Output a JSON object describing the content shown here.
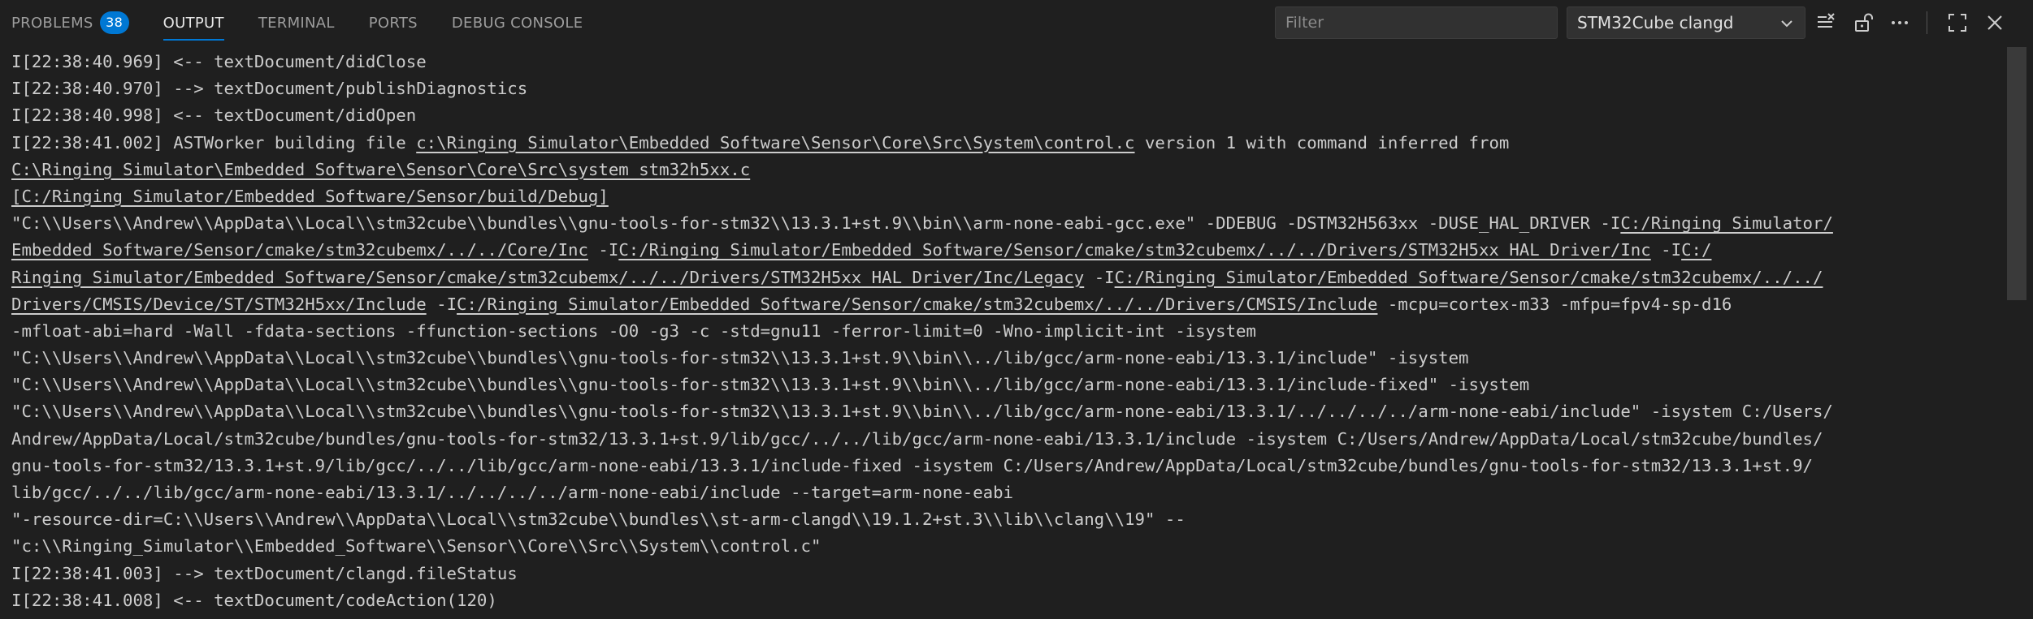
{
  "tabs": [
    {
      "label": "PROBLEMS",
      "badge": "38"
    },
    {
      "label": "OUTPUT"
    },
    {
      "label": "TERMINAL"
    },
    {
      "label": "PORTS"
    },
    {
      "label": "DEBUG CONSOLE"
    }
  ],
  "toolbar": {
    "filter_placeholder": "Filter",
    "channel_selected": "STM32Cube clangd",
    "icons": [
      "clear-output-icon",
      "lock-scroll-icon",
      "more-actions-icon",
      "maximize-panel-icon",
      "close-panel-icon"
    ]
  },
  "output": {
    "lines": [
      [
        {
          "t": "I[22:38:40.969] <-- textDocument/didClose"
        }
      ],
      [
        {
          "t": "I[22:38:40.970] --> textDocument/publishDiagnostics"
        }
      ],
      [
        {
          "t": "I[22:38:40.998] <-- textDocument/didOpen"
        }
      ],
      [
        {
          "t": "I[22:38:41.002] ASTWorker building file "
        },
        {
          "t": "c:\\Ringing_Simulator\\Embedded_Software\\Sensor\\Core\\Src\\System\\control.c",
          "link": true
        },
        {
          "t": " version 1 with command inferred from"
        }
      ],
      [
        {
          "t": "C:\\Ringing_Simulator\\Embedded_Software\\Sensor\\Core\\Src\\system_stm32h5xx.c",
          "link": true
        }
      ],
      [
        {
          "t": "[C:/Ringing_Simulator/Embedded_Software/Sensor/build/Debug]",
          "link": true
        }
      ],
      [
        {
          "t": "\"C:\\\\Users\\\\Andrew\\\\AppData\\\\Local\\\\stm32cube\\\\bundles\\\\gnu-tools-for-stm32\\\\13.3.1+st.9\\\\bin\\\\arm-none-eabi-gcc.exe\" -DDEBUG -DSTM32H563xx -DUSE_HAL_DRIVER -I"
        },
        {
          "t": "C:/Ringing_Simulator/",
          "link": true
        }
      ],
      [
        {
          "t": "Embedded_Software/Sensor/cmake/stm32cubemx/../../Core/Inc",
          "link": true
        },
        {
          "t": " -I"
        },
        {
          "t": "C:/Ringing_Simulator/Embedded_Software/Sensor/cmake/stm32cubemx/../../Drivers/STM32H5xx_HAL_Driver/Inc",
          "link": true
        },
        {
          "t": " -I"
        },
        {
          "t": "C:/",
          "link": true
        }
      ],
      [
        {
          "t": "Ringing_Simulator/Embedded_Software/Sensor/cmake/stm32cubemx/../../Drivers/STM32H5xx_HAL_Driver/Inc/Legacy",
          "link": true
        },
        {
          "t": " -I"
        },
        {
          "t": "C:/Ringing_Simulator/Embedded_Software/Sensor/cmake/stm32cubemx/../../",
          "link": true
        }
      ],
      [
        {
          "t": "Drivers/CMSIS/Device/ST/STM32H5xx/Include",
          "link": true
        },
        {
          "t": " -I"
        },
        {
          "t": "C:/Ringing_Simulator/Embedded_Software/Sensor/cmake/stm32cubemx/../../Drivers/CMSIS/Include",
          "link": true
        },
        {
          "t": " -mcpu=cortex-m33 -mfpu=fpv4-sp-d16"
        }
      ],
      [
        {
          "t": "-mfloat-abi=hard -Wall -fdata-sections -ffunction-sections -O0 -g3 -c -std=gnu11 -ferror-limit=0 -Wno-implicit-int -isystem"
        }
      ],
      [
        {
          "t": "\"C:\\\\Users\\\\Andrew\\\\AppData\\\\Local\\\\stm32cube\\\\bundles\\\\gnu-tools-for-stm32\\\\13.3.1+st.9\\\\bin\\\\../lib/gcc/arm-none-eabi/13.3.1/include\" -isystem"
        }
      ],
      [
        {
          "t": "\"C:\\\\Users\\\\Andrew\\\\AppData\\\\Local\\\\stm32cube\\\\bundles\\\\gnu-tools-for-stm32\\\\13.3.1+st.9\\\\bin\\\\../lib/gcc/arm-none-eabi/13.3.1/include-fixed\" -isystem"
        }
      ],
      [
        {
          "t": "\"C:\\\\Users\\\\Andrew\\\\AppData\\\\Local\\\\stm32cube\\\\bundles\\\\gnu-tools-for-stm32\\\\13.3.1+st.9\\\\bin\\\\../lib/gcc/arm-none-eabi/13.3.1/../../../../arm-none-eabi/include\" -isystem C:/Users/"
        }
      ],
      [
        {
          "t": "Andrew/AppData/Local/stm32cube/bundles/gnu-tools-for-stm32/13.3.1+st.9/lib/gcc/../../lib/gcc/arm-none-eabi/13.3.1/include -isystem C:/Users/Andrew/AppData/Local/stm32cube/bundles/"
        }
      ],
      [
        {
          "t": "gnu-tools-for-stm32/13.3.1+st.9/lib/gcc/../../lib/gcc/arm-none-eabi/13.3.1/include-fixed -isystem C:/Users/Andrew/AppData/Local/stm32cube/bundles/gnu-tools-for-stm32/13.3.1+st.9/"
        }
      ],
      [
        {
          "t": "lib/gcc/../../lib/gcc/arm-none-eabi/13.3.1/../../../../arm-none-eabi/include --target=arm-none-eabi"
        }
      ],
      [
        {
          "t": "\"-resource-dir=C:\\\\Users\\\\Andrew\\\\AppData\\\\Local\\\\stm32cube\\\\bundles\\\\st-arm-clangd\\\\19.1.2+st.3\\\\lib\\\\clang\\\\19\" --"
        }
      ],
      [
        {
          "t": "\"c:\\\\Ringing_Simulator\\\\Embedded_Software\\\\Sensor\\\\Core\\\\Src\\\\System\\\\control.c\""
        }
      ],
      [
        {
          "t": "I[22:38:41.003] --> textDocument/clangd.fileStatus"
        }
      ],
      [
        {
          "t": "I[22:38:41.008] <-- textDocument/codeAction(120)"
        }
      ]
    ]
  }
}
